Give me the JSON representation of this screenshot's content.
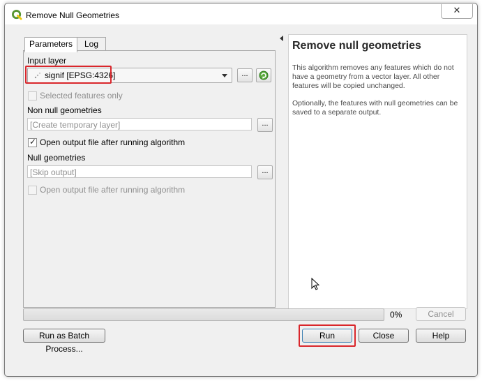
{
  "window": {
    "title": "Remove Null Geometries",
    "close_glyph": "✕"
  },
  "tabs": [
    {
      "label": "Parameters",
      "active": true
    },
    {
      "label": "Log",
      "active": false
    }
  ],
  "params": {
    "input_layer_label": "Input layer",
    "input_layer_value": "signif [EPSG:4326]",
    "browse_glyph": "...",
    "selected_only_label": "Selected features only",
    "selected_only_checked": false,
    "non_null_label": "Non null geometries",
    "non_null_placeholder": "[Create temporary layer]",
    "open_output_1_label": "Open output file after running algorithm",
    "open_output_1_checked": true,
    "null_label": "Null geometries",
    "null_placeholder": "[Skip output]",
    "open_output_2_label": "Open output file after running algorithm",
    "open_output_2_checked": false,
    "check_glyph": "✓"
  },
  "help": {
    "title": "Remove null geometries",
    "para1": "This algorithm removes any features which do not have a geometry from a vector layer. All other features will be copied unchanged.",
    "para2": "Optionally, the features with null geometries can be saved to a separate output."
  },
  "bottom": {
    "progress_percent": 0,
    "progress_label": "0%",
    "cancel_label": "Cancel",
    "batch_label": "Run as Batch Process...",
    "run_label": "Run",
    "close_label": "Close",
    "help_label": "Help"
  },
  "icons": {
    "app": "qgis-logo-icon",
    "layer": "point-layer-icon",
    "iterate": "iterate-green-icon",
    "cursor": "mouse-cursor-icon"
  },
  "colors": {
    "highlight": "#d9262b",
    "qgis_green": "#589632",
    "qgis_yellow": "#eec90d"
  }
}
